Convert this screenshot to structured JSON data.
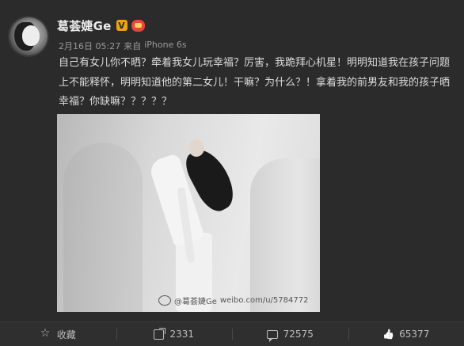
{
  "post": {
    "username": "葛荟婕Ge",
    "verified_badge": "V",
    "meta": {
      "date": "2月16日 05:27",
      "source_prefix": "来自",
      "source": "iPhone 6s"
    },
    "content": "自己有女儿你不晒？牵着我女儿玩幸福？厉害，我跪拜心机星！明明知道我在孩子问题上不能释怀，明明知道他的第二女儿！干嘛？为什么？！拿着我的前男友和我的孩子晒幸福？你缺嘛？？？？？",
    "image": {
      "watermark_handle": "@葛荟婕Ge",
      "watermark_url": "weibo.com/u/5784772"
    }
  },
  "actions": {
    "favorite_label": "收藏",
    "repost_count": "2331",
    "comment_count": "72575",
    "like_count": "65377"
  },
  "colors": {
    "background": "#2b2b2b",
    "verified": "#f0a20a",
    "vip": "#e7473d"
  }
}
